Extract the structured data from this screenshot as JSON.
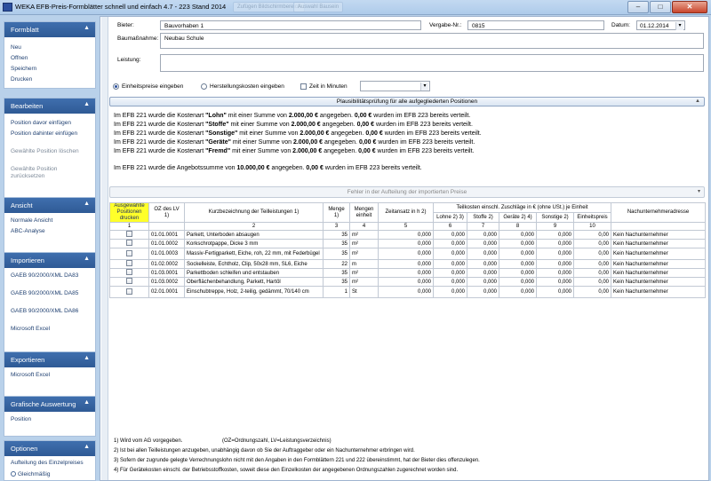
{
  "window": {
    "title": "WEKA EFB-Preis-Formblätter schnell und einfach 4.7 - 223 Stand 2014",
    "ghost_tabs": [
      "Zufügen Bildschirmbereich",
      "Auswahl Bausein"
    ]
  },
  "sidebar": {
    "sections": [
      {
        "title": "Formblatt",
        "items": [
          {
            "label": "Neu"
          },
          {
            "label": "Offnen"
          },
          {
            "label": "Speichern"
          },
          {
            "label": "Drucken"
          }
        ]
      },
      {
        "title": "Bearbeiten",
        "items": [
          {
            "label": "Position davor einfügen"
          },
          {
            "label": "Position dahinter einfügen"
          },
          {
            "label": "Gewählte Position löschen"
          },
          {
            "label": "Gewählte Position zurücksetzen"
          }
        ]
      },
      {
        "title": "Ansicht",
        "items": [
          {
            "label": "Normale Ansicht"
          },
          {
            "label": "ABC-Analyse"
          }
        ]
      },
      {
        "title": "Importieren",
        "items": [
          {
            "label": "GAEB 90/2000/XML DA83"
          },
          {
            "label": "GAEB 90/2000/XML DA85"
          },
          {
            "label": "GAEB 90/2000/XML DA86"
          },
          {
            "label": "Microsoft Excel"
          }
        ]
      },
      {
        "title": "Exportieren",
        "items": [
          {
            "label": "Microsoft Excel"
          }
        ]
      },
      {
        "title": "Grafische Auswertung",
        "items": [
          {
            "label": "Position"
          }
        ]
      },
      {
        "title": "Optionen",
        "items": [
          {
            "label": "Aufteilung des Einzelpreises"
          },
          {
            "label": "Gleichmäßig"
          }
        ]
      }
    ]
  },
  "form": {
    "bieter_label": "Bieter:",
    "bieter_value": "Bauvorhaben 1",
    "vergabe_label": "Vergabe-Nr.:",
    "vergabe_value": "0815",
    "datum_label": "Datum:",
    "datum_value": "01.12.2014",
    "baumassnahme_label": "Baumaßnahme:",
    "baumassnahme_value": "Neubau Schule",
    "leistung_label": "Leistung:",
    "leistung_value": ""
  },
  "options": {
    "einheitspreise": "Einheitspreise eingeben",
    "herstellung": "Herstellungskosten eingeben",
    "zeit": "Zeit in Minuten",
    "dropdown_value": ""
  },
  "plausi_button": "Plausibilitätsprüfung für alle aufgegliederten Positionen",
  "messages": [
    {
      "pre": "Im EFB 221 wurde die Kostenart ",
      "bold1": "\"Lohn\"",
      "mid": " mit einer Summe von ",
      "bold2": "2.000,00 €",
      "mid2": " angegeben. ",
      "bold3": "0,00 €",
      "post": " wurden im EFB 223 bereits verteilt."
    },
    {
      "pre": "Im EFB 221 wurde die Kostenart ",
      "bold1": "\"Stoffe\"",
      "mid": " mit einer Summe von ",
      "bold2": "2.000,00 €",
      "mid2": " angegeben. ",
      "bold3": "0,00 €",
      "post": " wurden im EFB 223 bereits verteilt."
    },
    {
      "pre": "Im EFB 221 wurde die Kostenart ",
      "bold1": "\"Sonstige\"",
      "mid": " mit einer Summe von ",
      "bold2": "2.000,00 €",
      "mid2": " angegeben. ",
      "bold3": "0,00 €",
      "post": " wurden im EFB 223 bereits verteilt."
    },
    {
      "pre": "Im EFB 221 wurde die Kostenart ",
      "bold1": "\"Geräte\"",
      "mid": " mit einer Summe von ",
      "bold2": "2.000,00 €",
      "mid2": " angegeben. ",
      "bold3": "0,00 €",
      "post": " wurden im EFB 223 bereits verteilt."
    },
    {
      "pre": "Im EFB 221 wurde die Kostenart ",
      "bold1": "\"Fremd\"",
      "mid": " mit einer Summe von ",
      "bold2": "2.000,00 €",
      "mid2": " angegeben. ",
      "bold3": "0,00 €",
      "post": " wurden im EFB 223 bereits verteilt."
    }
  ],
  "summary": {
    "pre": "Im EFB 221 wurde die Angebotssumme von ",
    "bold1": "10.000,00 €",
    "mid": " angegeben. ",
    "bold2": "0,00 €",
    "post": " wurden im EFB 223 bereits verteilt."
  },
  "error_bar": "Fehler in der Aufteilung der importierten Preise",
  "table": {
    "h_select": "Ausgewählte Positionen drucken",
    "h_oz": "OZ des LV 1)",
    "h_kurz": "Kurzbezeichnung der Teilleistungen 1)",
    "h_menge": "Menge 1)",
    "h_einheit": "Mengen einheit",
    "h_zeit": "Zeitansatz in h 2)",
    "h_teil": "Teilkosten einschl. Zuschläge in € (ohne USt.) je Einheit",
    "h_lohn": "Lohne 2) 3)",
    "h_stoffe": "Stoffe 2)",
    "h_geraete": "Geräte 2) 4)",
    "h_sonstige": "Sonstige 2)",
    "h_ep": "Einheitspreis",
    "h_nu": "Nachunternehmeradresse",
    "colnums": [
      "1",
      "2",
      "3",
      "4",
      "5",
      "6",
      "7",
      "8",
      "9",
      "10"
    ],
    "rows": [
      {
        "oz": "01.01.0001",
        "kurz": "Parkett, Unterboden absaugen",
        "menge": "35",
        "einheit": "m²",
        "zeit": "0,000",
        "lohn": "0,000",
        "stoffe": "0,000",
        "geraete": "0,000",
        "sonstige": "0,000",
        "ep": "0,00",
        "nu": "Kein Nachunternehmer"
      },
      {
        "oz": "01.01.0002",
        "kurz": "Korkschrotpappe, Dicke 3 mm",
        "menge": "35",
        "einheit": "m²",
        "zeit": "0,000",
        "lohn": "0,000",
        "stoffe": "0,000",
        "geraete": "0,000",
        "sonstige": "0,000",
        "ep": "0,00",
        "nu": "Kein Nachunternehmer"
      },
      {
        "oz": "01.01.0003",
        "kurz": "Massiv-Fertigparkett, Eiche, roh, 22 mm, mit Federbügel",
        "menge": "35",
        "einheit": "m²",
        "zeit": "0,000",
        "lohn": "0,000",
        "stoffe": "0,000",
        "geraete": "0,000",
        "sonstige": "0,000",
        "ep": "0,00",
        "nu": "Kein Nachunternehmer"
      },
      {
        "oz": "01.02.0002",
        "kurz": "Sockelleiste, Echtholz, Clip, 50x28 mm, SL6, Eiche",
        "menge": "22",
        "einheit": "m",
        "zeit": "0,000",
        "lohn": "0,000",
        "stoffe": "0,000",
        "geraete": "0,000",
        "sonstige": "0,000",
        "ep": "0,00",
        "nu": "Kein Nachunternehmer"
      },
      {
        "oz": "01.03.0001",
        "kurz": "Parkettboden schleifen und entstauben",
        "menge": "35",
        "einheit": "m²",
        "zeit": "0,000",
        "lohn": "0,000",
        "stoffe": "0,000",
        "geraete": "0,000",
        "sonstige": "0,000",
        "ep": "0,00",
        "nu": "Kein Nachunternehmer"
      },
      {
        "oz": "01.03.0002",
        "kurz": "Oberflächenbehandlung, Parkett, Hartöl",
        "menge": "35",
        "einheit": "m²",
        "zeit": "0,000",
        "lohn": "0,000",
        "stoffe": "0,000",
        "geraete": "0,000",
        "sonstige": "0,000",
        "ep": "0,00",
        "nu": "Kein Nachunternehmer"
      },
      {
        "oz": "02.01.0001",
        "kurz": "Einschubtreppe, Holz, 2-teilig, gedämmt, 70/140 cm",
        "menge": "1",
        "einheit": "St",
        "zeit": "0,000",
        "lohn": "0,000",
        "stoffe": "0,000",
        "geraete": "0,000",
        "sonstige": "0,000",
        "ep": "0,00",
        "nu": "Kein Nachunternehmer"
      }
    ]
  },
  "footnotes": {
    "f1": "1)  Wird vom AG vorgegeben.",
    "f1b": "(OZ=Ordnungszahl, LV=Leistungsverzeichnis)",
    "f2": "2)  Ist bei allen Teilleistungen anzugeben, unabhängig davon ob Sie der Auftraggeber oder ein Nachunternehmer erbringen wird.",
    "f3": "3)  Sofern der zugrunde gelegte Verrechnungslohn nicht mit den Angaben in den Formblättern 221 und 222 übereinstimmt, hat der Bieter dies offenzulegen.",
    "f4": "4)  Für Gerätekosten einschl. der Betriebsstoffkosten, soweit diese den Einzelkosten der angegebenen Ordnungszahlen zugerechnet worden sind."
  }
}
